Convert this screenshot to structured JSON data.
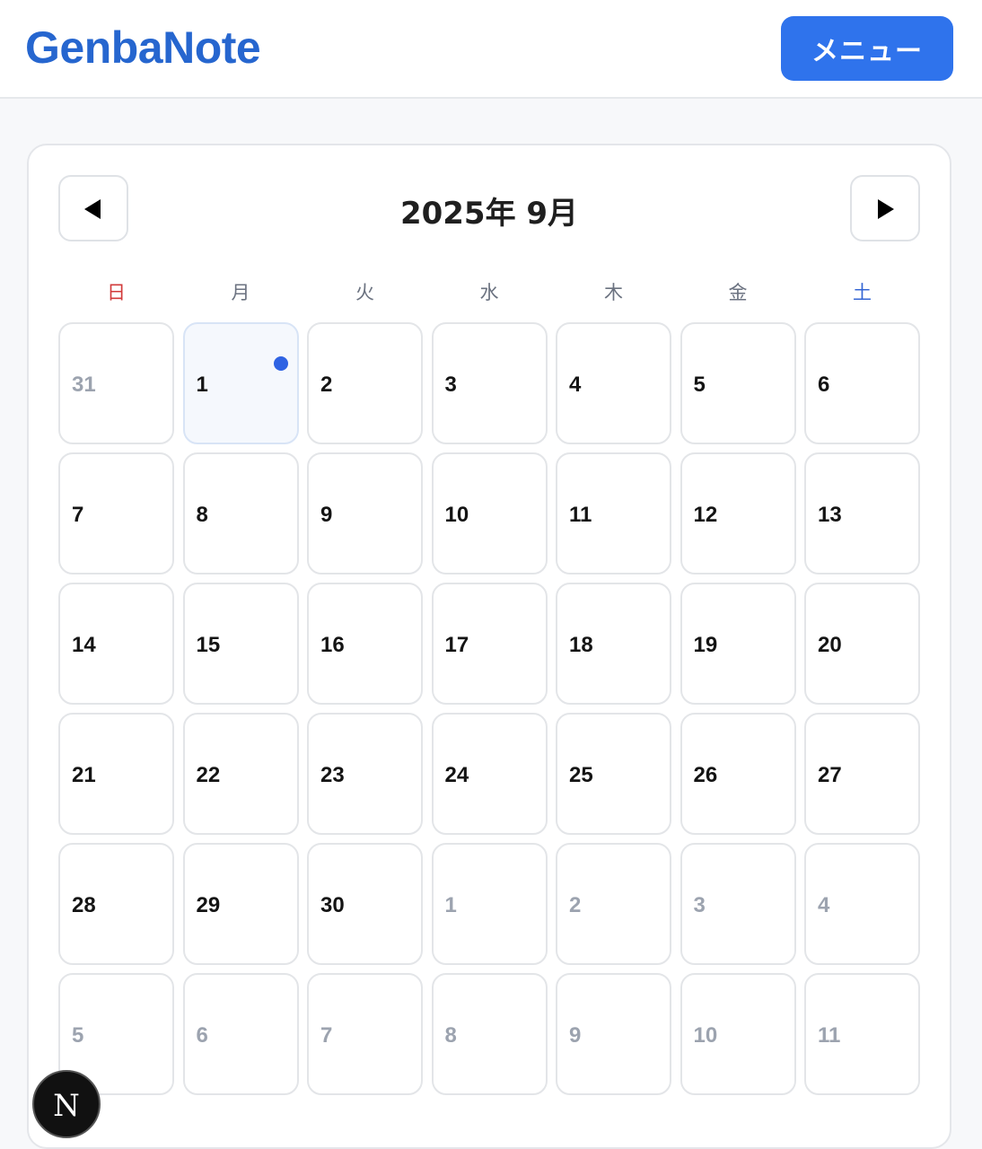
{
  "app": {
    "title": "GenbaNote",
    "menu_label": "メニュー"
  },
  "calendar": {
    "month_title": "2025年 9月",
    "weekdays": [
      "日",
      "月",
      "火",
      "水",
      "木",
      "金",
      "土"
    ],
    "days": [
      {
        "label": "31",
        "other": true
      },
      {
        "label": "1",
        "today": true,
        "has_event": true
      },
      {
        "label": "2"
      },
      {
        "label": "3"
      },
      {
        "label": "4"
      },
      {
        "label": "5"
      },
      {
        "label": "6"
      },
      {
        "label": "7"
      },
      {
        "label": "8"
      },
      {
        "label": "9"
      },
      {
        "label": "10"
      },
      {
        "label": "11"
      },
      {
        "label": "12"
      },
      {
        "label": "13"
      },
      {
        "label": "14"
      },
      {
        "label": "15"
      },
      {
        "label": "16"
      },
      {
        "label": "17"
      },
      {
        "label": "18"
      },
      {
        "label": "19"
      },
      {
        "label": "20"
      },
      {
        "label": "21"
      },
      {
        "label": "22"
      },
      {
        "label": "23"
      },
      {
        "label": "24"
      },
      {
        "label": "25"
      },
      {
        "label": "26"
      },
      {
        "label": "27"
      },
      {
        "label": "28"
      },
      {
        "label": "29"
      },
      {
        "label": "30"
      },
      {
        "label": "1",
        "other": true
      },
      {
        "label": "2",
        "other": true
      },
      {
        "label": "3",
        "other": true
      },
      {
        "label": "4",
        "other": true
      },
      {
        "label": "5",
        "other": true
      },
      {
        "label": "6",
        "other": true
      },
      {
        "label": "7",
        "other": true
      },
      {
        "label": "8",
        "other": true
      },
      {
        "label": "9",
        "other": true
      },
      {
        "label": "10",
        "other": true
      },
      {
        "label": "11",
        "other": true
      }
    ]
  },
  "fab": {
    "label": "N"
  },
  "colors": {
    "brand": "#2666cf",
    "button": "#2f73ec",
    "event_dot": "#2f63e3",
    "sunday": "#d23b3b",
    "saturday": "#3566d4"
  },
  "icons": {
    "prev": "triangle-left-icon",
    "next": "triangle-right-icon"
  }
}
